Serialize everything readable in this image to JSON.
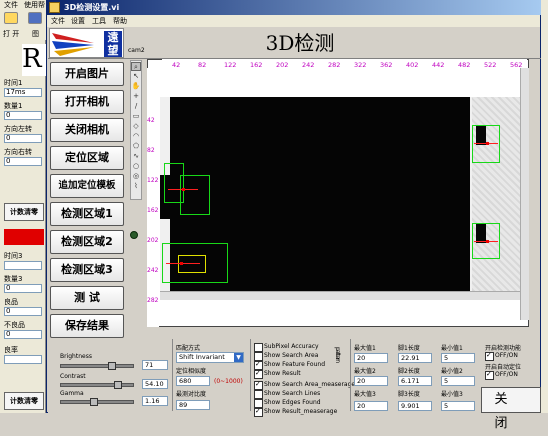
{
  "background_app": {
    "menu": [
      "文件",
      "使用帮"
    ],
    "toolbar": [
      "打 开",
      "图"
    ],
    "big_letter": "R",
    "fields": [
      {
        "label": "时间1",
        "value": "17ms"
      },
      {
        "label": "数量1",
        "value": "0"
      },
      {
        "label": "方向左转",
        "value": "0"
      },
      {
        "label": "方向右转",
        "value": "0"
      }
    ],
    "fields2": [
      {
        "label": "时间3",
        "value": ""
      },
      {
        "label": "数量3",
        "value": "0"
      },
      {
        "label": "良品",
        "value": "0"
      },
      {
        "label": "不良品",
        "value": "0"
      },
      {
        "label": "良率",
        "value": ""
      }
    ],
    "reset_label": "计数清零",
    "reset_label2": "计数清零"
  },
  "window": {
    "title": "3D检测设置.vi",
    "menu": [
      "文件",
      "设置",
      "工具",
      "帮助"
    ],
    "logo_text": "遠望",
    "camera_label": "cam2",
    "heading": "3D检测"
  },
  "left_buttons": [
    "开启图片",
    "打开相机",
    "关闭相机",
    "定位区域",
    "追加定位模板",
    "检测区域1",
    "检测区域2",
    "检测区域3",
    "测  试",
    "保存结果"
  ],
  "ruler": {
    "x_ticks": [
      "42",
      "82",
      "122",
      "162",
      "202",
      "242",
      "282",
      "322",
      "362",
      "402",
      "442",
      "482",
      "522",
      "562"
    ],
    "y_ticks": [
      "42",
      "82",
      "122",
      "162",
      "202",
      "242",
      "282"
    ]
  },
  "image_controls": {
    "brightness_label": "Brightness",
    "brightness_value": "71",
    "contrast_label": "Contrast",
    "contrast_value": "54.10",
    "gamma_label": "Gamma",
    "gamma_value": "1.16"
  },
  "match": {
    "method_label": "匹配方式",
    "method_value": "Shift Invariant",
    "similarity_label": "定位相似度",
    "similarity_value": "680",
    "similarity_range": "(0~1000)",
    "contrast_label": "最测对比度",
    "contrast_value": "89"
  },
  "options": {
    "items": [
      {
        "label": "SubPixel Accuracy",
        "checked": false
      },
      {
        "label": "Show Search Area",
        "checked": false
      },
      {
        "label": "Show Feature Found",
        "checked": true
      },
      {
        "label": "Show Result",
        "checked": true
      }
    ],
    "vertical_label": "pattern",
    "items2": [
      {
        "label": "Show Search Area_measerage",
        "checked": true
      },
      {
        "label": "Show Search Lines",
        "checked": false
      },
      {
        "label": "Show Edges Found",
        "checked": false
      },
      {
        "label": "Show Result_measerage",
        "checked": true
      }
    ]
  },
  "measure": {
    "max_labels": [
      "最大值1",
      "最大值2",
      "最大值3"
    ],
    "max_values": [
      "20",
      "20",
      "20"
    ],
    "len_labels": [
      "脚1长度",
      "脚2长度",
      "脚3长度"
    ],
    "len_values": [
      "22.91",
      "6.171",
      "9.901"
    ],
    "min_labels": [
      "最小值1",
      "最小值2",
      "最小值3"
    ],
    "min_values": [
      "5",
      "5",
      "5"
    ]
  },
  "switches": {
    "detect_label": "开启检测功能",
    "detect_value": "OFF/ON",
    "autoloc_label": "开启自动定位",
    "autoloc_value": "OFF/ON"
  },
  "close_label": "关闭",
  "colors": {
    "roi": "#18d818",
    "ruler_text": "#c000c0",
    "title_bar": "#0a246a"
  }
}
